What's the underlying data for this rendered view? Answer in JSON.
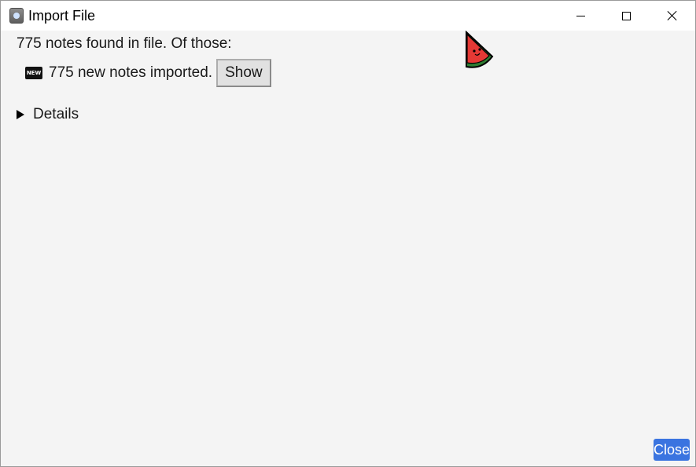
{
  "window": {
    "title": "Import File",
    "controls": {
      "minimize_icon": "minimize-icon",
      "maximize_icon": "maximize-icon",
      "close_icon": "close-icon"
    }
  },
  "content": {
    "summary": "775 notes found in file. Of those:",
    "new_badge": "NEW",
    "new_notes_text": "775 new notes imported.",
    "show_button": "Show",
    "details_label": "Details"
  },
  "footer": {
    "close_button": "Close",
    "close_button_color": "#3a74e0"
  }
}
